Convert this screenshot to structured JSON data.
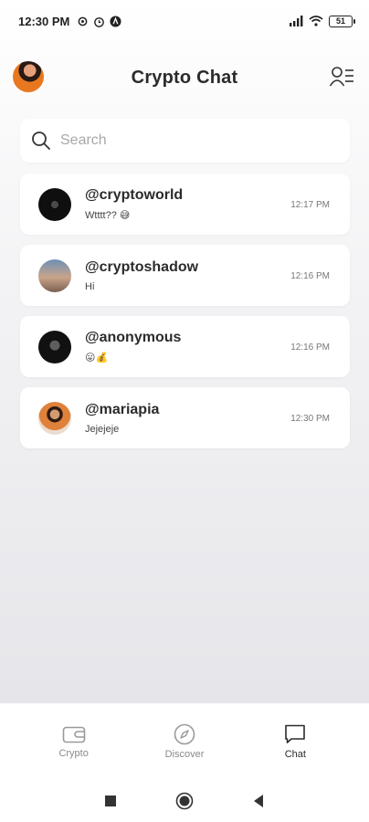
{
  "status_bar": {
    "time": "12:30 PM",
    "battery": "51",
    "icons": [
      "settings-gear-icon",
      "alarm-icon",
      "a-badge-icon",
      "signal-icon",
      "wifi-icon"
    ]
  },
  "header": {
    "title": "Crypto Chat"
  },
  "search": {
    "placeholder": "Search",
    "value": ""
  },
  "chats": [
    {
      "name": "@cryptoworld",
      "message": "Wtttt?? 😅",
      "time": "12:17 PM"
    },
    {
      "name": "@cryptoshadow",
      "message": "Hi",
      "time": "12:16 PM"
    },
    {
      "name": "@anonymous",
      "message": "😛💰",
      "time": "12:16 PM"
    },
    {
      "name": "@mariapia",
      "message": "Jejejeje",
      "time": "12:30 PM"
    }
  ],
  "bottom_nav": {
    "items": [
      {
        "label": "Crypto",
        "icon": "wallet-icon",
        "active": false
      },
      {
        "label": "Discover",
        "icon": "compass-icon",
        "active": false
      },
      {
        "label": "Chat",
        "icon": "chat-bubble-icon",
        "active": true
      }
    ]
  },
  "colors": {
    "accent_active": "#2b2b2b",
    "inactive": "#8a8a8a",
    "card": "#ffffff"
  }
}
